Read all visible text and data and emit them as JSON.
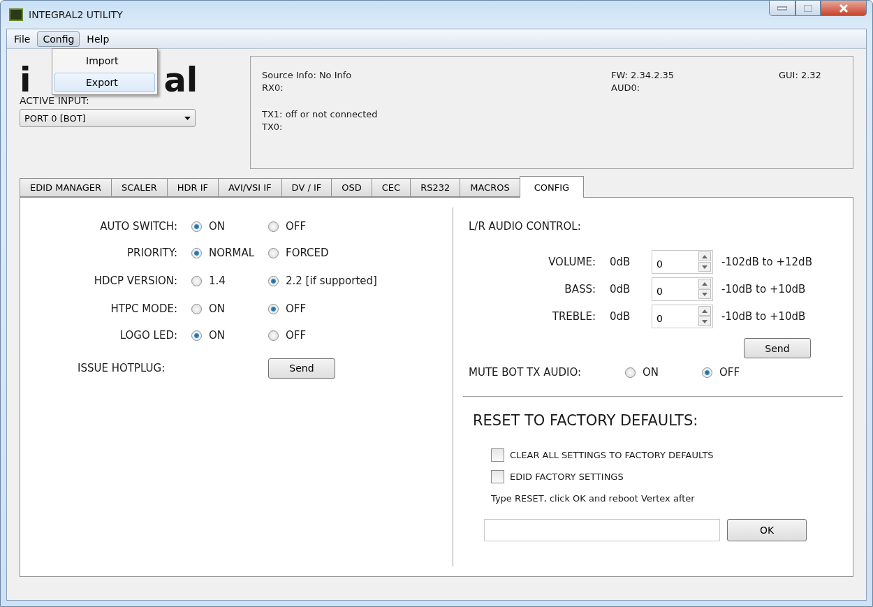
{
  "window": {
    "title": "INTEGRAL2 UTILITY"
  },
  "menu": [
    {
      "label": "File",
      "selected": false
    },
    {
      "label": "Config",
      "selected": true
    },
    {
      "label": "Help",
      "selected": false
    }
  ],
  "open_menu": {
    "items": [
      {
        "label": "Import",
        "selected": false
      },
      {
        "label": "Export",
        "selected": true
      }
    ]
  },
  "logo": {
    "left": "i",
    "right": "al"
  },
  "active_input": {
    "label": "ACTIVE INPUT:",
    "value": "PORT 0 [BOT]"
  },
  "info": {
    "source": "Source Info: No Info",
    "rx": "RX0:",
    "tx1": "TX1: off or not connected",
    "tx0": "TX0:",
    "fw": "FW: 2.34.2.35",
    "aud": "AUD0:",
    "gui": "GUI: 2.32"
  },
  "tabs": [
    {
      "label": "EDID MANAGER",
      "selected": false
    },
    {
      "label": "SCALER",
      "selected": false
    },
    {
      "label": "HDR IF",
      "selected": false
    },
    {
      "label": "AVI/VSI IF",
      "selected": false
    },
    {
      "label": "DV / IF",
      "selected": false
    },
    {
      "label": "OSD",
      "selected": false
    },
    {
      "label": "CEC",
      "selected": false
    },
    {
      "label": "RS232",
      "selected": false
    },
    {
      "label": "MACROS",
      "selected": false
    },
    {
      "label": "CONFIG",
      "selected": true
    }
  ],
  "settings": [
    {
      "label": "AUTO SWITCH:",
      "options": [
        {
          "label": "ON",
          "selected": true
        },
        {
          "label": "OFF",
          "selected": false
        }
      ]
    },
    {
      "label": "PRIORITY:",
      "options": [
        {
          "label": "NORMAL",
          "selected": true
        },
        {
          "label": "FORCED",
          "selected": false
        }
      ]
    },
    {
      "label": "HDCP VERSION:",
      "options": [
        {
          "label": "1.4",
          "selected": false
        },
        {
          "label": "2.2 [if supported]",
          "selected": true
        }
      ]
    },
    {
      "label": "HTPC MODE:",
      "options": [
        {
          "label": "ON",
          "selected": false
        },
        {
          "label": "OFF",
          "selected": true
        }
      ]
    },
    {
      "label": "LOGO LED:",
      "options": [
        {
          "label": "ON",
          "selected": true
        },
        {
          "label": "OFF",
          "selected": false
        }
      ]
    }
  ],
  "hotplug": {
    "label": "ISSUE HOTPLUG:",
    "button": "Send"
  },
  "audio": {
    "title": "L/R AUDIO CONTROL:",
    "rows": [
      {
        "label": "VOLUME:",
        "reading": "0dB",
        "value": "0",
        "range": "-102dB to +12dB"
      },
      {
        "label": "BASS:",
        "reading": "0dB",
        "value": "0",
        "range": "-10dB to +10dB"
      },
      {
        "label": "TREBLE:",
        "reading": "0dB",
        "value": "0",
        "range": "-10dB to +10dB"
      }
    ],
    "button": "Send"
  },
  "mute": {
    "label": "MUTE BOT TX AUDIO:",
    "options": [
      {
        "label": "ON",
        "selected": false
      },
      {
        "label": "OFF",
        "selected": true
      }
    ]
  },
  "reset": {
    "title": "RESET TO FACTORY DEFAULTS:",
    "checks": [
      {
        "label": "CLEAR ALL SETTINGS TO FACTORY DEFAULTS",
        "checked": false
      },
      {
        "label": "EDID FACTORY SETTINGS",
        "checked": false
      }
    ],
    "note": "Type RESET, click OK and reboot Vertex after",
    "button": "OK"
  }
}
